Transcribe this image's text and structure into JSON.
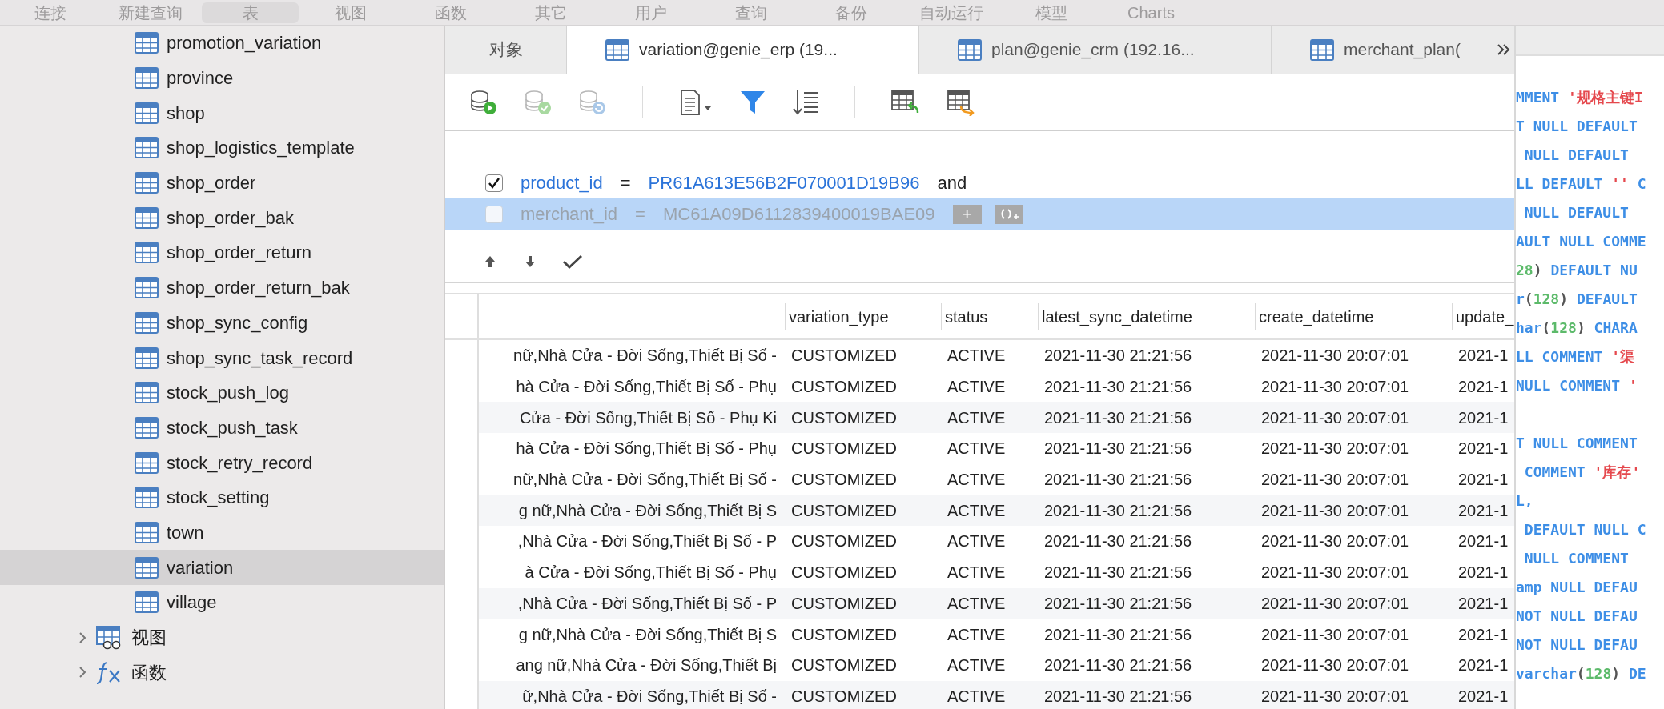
{
  "menu": [
    {
      "label": "连接",
      "selected": false
    },
    {
      "label": "新建查询",
      "selected": false
    },
    {
      "label": "表",
      "selected": true
    },
    {
      "label": "视图",
      "selected": false
    },
    {
      "label": "函数",
      "selected": false
    },
    {
      "label": "其它",
      "selected": false
    },
    {
      "label": "用户",
      "selected": false
    },
    {
      "label": "查询",
      "selected": false
    },
    {
      "label": "备份",
      "selected": false
    },
    {
      "label": "自动运行",
      "selected": false
    },
    {
      "label": "模型",
      "selected": false
    },
    {
      "label": "Charts",
      "selected": false
    }
  ],
  "sidebar": {
    "tables": [
      {
        "label": "promotion_variation",
        "selected": false
      },
      {
        "label": "province",
        "selected": false
      },
      {
        "label": "shop",
        "selected": false
      },
      {
        "label": "shop_logistics_template",
        "selected": false
      },
      {
        "label": "shop_order",
        "selected": false
      },
      {
        "label": "shop_order_bak",
        "selected": false
      },
      {
        "label": "shop_order_return",
        "selected": false
      },
      {
        "label": "shop_order_return_bak",
        "selected": false
      },
      {
        "label": "shop_sync_config",
        "selected": false
      },
      {
        "label": "shop_sync_task_record",
        "selected": false
      },
      {
        "label": "stock_push_log",
        "selected": false
      },
      {
        "label": "stock_push_task",
        "selected": false
      },
      {
        "label": "stock_retry_record",
        "selected": false
      },
      {
        "label": "stock_setting",
        "selected": false
      },
      {
        "label": "town",
        "selected": false
      },
      {
        "label": "variation",
        "selected": true
      },
      {
        "label": "village",
        "selected": false
      }
    ],
    "groups": [
      {
        "kind": "views",
        "label": "视图",
        "expanded": false
      },
      {
        "kind": "functions",
        "label": "函数",
        "expanded": false
      }
    ]
  },
  "tabs": [
    {
      "kind": "objects",
      "label": "对象",
      "selected": false
    },
    {
      "kind": "table",
      "label": "variation@genie_erp (19...",
      "selected": true
    },
    {
      "kind": "table",
      "label": "plan@genie_crm (192.16...",
      "selected": false
    },
    {
      "kind": "table",
      "label": "merchant_plan(",
      "selected": false
    }
  ],
  "toolbar": [
    {
      "kind": "run",
      "disabled": false
    },
    {
      "kind": "commit",
      "disabled": true
    },
    {
      "kind": "rollback",
      "disabled": true
    },
    {
      "kind": "separator"
    },
    {
      "kind": "document",
      "disabled": false
    },
    {
      "kind": "filter",
      "disabled": false
    },
    {
      "kind": "sort",
      "disabled": false
    },
    {
      "kind": "separator"
    },
    {
      "kind": "import",
      "disabled": false
    },
    {
      "kind": "export",
      "disabled": false
    }
  ],
  "filters": [
    {
      "checked": true,
      "selected": false,
      "field": "product_id",
      "operator": "=",
      "value": "PR61A613E56B2F070001D19B96",
      "conjunction": "and"
    },
    {
      "checked": false,
      "selected": true,
      "field": "merchant_id",
      "operator": "=",
      "value": "MC61A09D6112839400019BAE09",
      "add_label": "+"
    }
  ],
  "table": {
    "columns": [
      "",
      "variation_type",
      "status",
      "latest_sync_datetime",
      "create_datetime",
      "update_"
    ],
    "rows": [
      [
        "nữ,Nhà Cửa - Đời Sống,Thiết Bị Số -",
        "CUSTOMIZED",
        "ACTIVE",
        "2021-11-30 21:21:56",
        "2021-11-30 20:07:01",
        "2021-1"
      ],
      [
        "hà Cửa - Đời Sống,Thiết Bị Số - Phụ",
        "CUSTOMIZED",
        "ACTIVE",
        "2021-11-30 21:21:56",
        "2021-11-30 20:07:01",
        "2021-1"
      ],
      [
        "Cửa - Đời Sống,Thiết Bị Số - Phụ Ki",
        "CUSTOMIZED",
        "ACTIVE",
        "2021-11-30 21:21:56",
        "2021-11-30 20:07:01",
        "2021-1"
      ],
      [
        "hà Cửa - Đời Sống,Thiết Bị Số - Phụ",
        "CUSTOMIZED",
        "ACTIVE",
        "2021-11-30 21:21:56",
        "2021-11-30 20:07:01",
        "2021-1"
      ],
      [
        "nữ,Nhà Cửa - Đời Sống,Thiết Bị Số -",
        "CUSTOMIZED",
        "ACTIVE",
        "2021-11-30 21:21:56",
        "2021-11-30 20:07:01",
        "2021-1"
      ],
      [
        "g nữ,Nhà Cửa - Đời Sống,Thiết Bị S",
        "CUSTOMIZED",
        "ACTIVE",
        "2021-11-30 21:21:56",
        "2021-11-30 20:07:01",
        "2021-1"
      ],
      [
        ",Nhà Cửa - Đời Sống,Thiết Bị Số - P",
        "CUSTOMIZED",
        "ACTIVE",
        "2021-11-30 21:21:56",
        "2021-11-30 20:07:01",
        "2021-1"
      ],
      [
        "à Cửa - Đời Sống,Thiết Bị Số - Phụ",
        "CUSTOMIZED",
        "ACTIVE",
        "2021-11-30 21:21:56",
        "2021-11-30 20:07:01",
        "2021-1"
      ],
      [
        ",Nhà Cửa - Đời Sống,Thiết Bị Số - P",
        "CUSTOMIZED",
        "ACTIVE",
        "2021-11-30 21:21:56",
        "2021-11-30 20:07:01",
        "2021-1"
      ],
      [
        "g nữ,Nhà Cửa - Đời Sống,Thiết Bị S",
        "CUSTOMIZED",
        "ACTIVE",
        "2021-11-30 21:21:56",
        "2021-11-30 20:07:01",
        "2021-1"
      ],
      [
        "ang nữ,Nhà Cửa - Đời Sống,Thiết Bị",
        "CUSTOMIZED",
        "ACTIVE",
        "2021-11-30 21:21:56",
        "2021-11-30 20:07:01",
        "2021-1"
      ],
      [
        "ữ,Nhà Cửa - Đời Sống,Thiết Bị Số -",
        "CUSTOMIZED",
        "ACTIVE",
        "2021-11-30 21:21:56",
        "2021-11-30 20:07:01",
        "2021-1"
      ]
    ]
  },
  "code_blocks": [
    [
      {
        "tokens": [
          {
            "kind": "keyword",
            "text": "MMENT "
          },
          {
            "kind": "string",
            "text": "'规格主键I"
          }
        ]
      },
      {
        "tokens": [
          {
            "kind": "keyword",
            "text": "T NULL DEFAULT"
          }
        ]
      },
      {
        "tokens": [
          {
            "kind": "keyword",
            "text": " NULL DEFAULT"
          }
        ]
      },
      {
        "tokens": [
          {
            "kind": "keyword",
            "text": "LL DEFAULT "
          },
          {
            "kind": "string",
            "text": "''"
          },
          {
            "kind": "keyword",
            "text": " C"
          }
        ]
      },
      {
        "tokens": [
          {
            "kind": "keyword",
            "text": " NULL DEFAULT"
          }
        ]
      },
      {
        "tokens": [
          {
            "kind": "keyword",
            "text": "AULT NULL COMME"
          }
        ]
      },
      {
        "tokens": [
          {
            "kind": "number",
            "text": "28"
          },
          {
            "kind": "punct",
            "text": ") "
          },
          {
            "kind": "keyword",
            "text": "DEFAULT NU"
          }
        ]
      },
      {
        "tokens": [
          {
            "kind": "keyword",
            "text": "r"
          },
          {
            "kind": "punct",
            "text": "("
          },
          {
            "kind": "number",
            "text": "128"
          },
          {
            "kind": "punct",
            "text": ") "
          },
          {
            "kind": "keyword",
            "text": "DEFAULT"
          }
        ]
      },
      {
        "tokens": [
          {
            "kind": "keyword",
            "text": "har"
          },
          {
            "kind": "punct",
            "text": "("
          },
          {
            "kind": "number",
            "text": "128"
          },
          {
            "kind": "punct",
            "text": ") "
          },
          {
            "kind": "keyword",
            "text": "CHARA"
          }
        ]
      },
      {
        "tokens": [
          {
            "kind": "keyword",
            "text": "LL COMMENT "
          },
          {
            "kind": "string",
            "text": "'渠"
          }
        ]
      },
      {
        "tokens": [
          {
            "kind": "keyword",
            "text": "NULL COMMENT "
          },
          {
            "kind": "string",
            "text": "'"
          }
        ]
      }
    ],
    [
      {
        "tokens": [
          {
            "kind": "keyword",
            "text": "T NULL COMMENT"
          }
        ]
      },
      {
        "tokens": [
          {
            "kind": "keyword",
            "text": " COMMENT "
          },
          {
            "kind": "string",
            "text": "'库存'"
          }
        ]
      },
      {
        "tokens": [
          {
            "kind": "keyword",
            "text": "L,"
          }
        ]
      },
      {
        "tokens": [
          {
            "kind": "keyword",
            "text": " DEFAULT NULL C"
          }
        ]
      },
      {
        "tokens": [
          {
            "kind": "keyword",
            "text": " NULL COMMENT"
          }
        ]
      },
      {
        "tokens": [
          {
            "kind": "keyword",
            "text": "amp NULL DEFAU"
          }
        ]
      },
      {
        "tokens": [
          {
            "kind": "keyword",
            "text": "NOT NULL DEFAU"
          }
        ]
      },
      {
        "tokens": [
          {
            "kind": "keyword",
            "text": "NOT NULL DEFAU"
          }
        ]
      },
      {
        "tokens": [
          {
            "kind": "keyword",
            "text": "varchar"
          },
          {
            "kind": "punct",
            "text": "("
          },
          {
            "kind": "number",
            "text": "128"
          },
          {
            "kind": "punct",
            "text": ") "
          },
          {
            "kind": "keyword",
            "text": "DE"
          }
        ]
      }
    ]
  ]
}
